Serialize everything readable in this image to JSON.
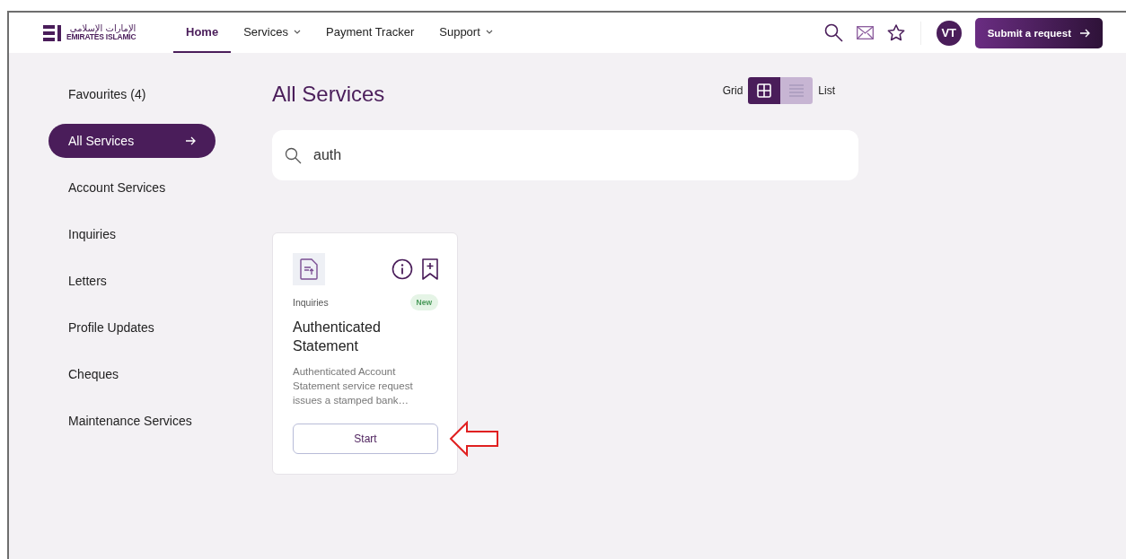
{
  "logo": {
    "arabic": "الإمارات الإسلامي",
    "latin": "EMIRATES ISLAMIC"
  },
  "nav": [
    {
      "label": "Home",
      "selected": true,
      "dropdown": false
    },
    {
      "label": "Services",
      "selected": false,
      "dropdown": true
    },
    {
      "label": "Payment Tracker",
      "selected": false,
      "dropdown": false
    },
    {
      "label": "Support",
      "selected": false,
      "dropdown": true
    }
  ],
  "user": {
    "initials": "VT"
  },
  "submit_button": {
    "label": "Submit a request"
  },
  "sidebar": {
    "items": [
      {
        "label": "Favourites (4)",
        "selected": false
      },
      {
        "label": "All Services",
        "selected": true
      },
      {
        "label": "Account Services",
        "selected": false
      },
      {
        "label": "Inquiries",
        "selected": false
      },
      {
        "label": "Letters",
        "selected": false
      },
      {
        "label": "Profile Updates",
        "selected": false
      },
      {
        "label": "Cheques",
        "selected": false
      },
      {
        "label": "Maintenance Services",
        "selected": false
      }
    ]
  },
  "page_title": "All Services",
  "view_toggle": {
    "grid_label": "Grid",
    "list_label": "List",
    "options": [
      {
        "kind": "grid",
        "selected": true
      },
      {
        "kind": "list",
        "selected": false
      }
    ]
  },
  "search": {
    "value": "auth"
  },
  "cards": [
    {
      "category": "Inquiries",
      "badge": "New",
      "title": "Authenticated Statement",
      "description": "Authenticated Account Statement service request issues a stamped bank…",
      "button": "Start",
      "highlighted": true
    }
  ]
}
